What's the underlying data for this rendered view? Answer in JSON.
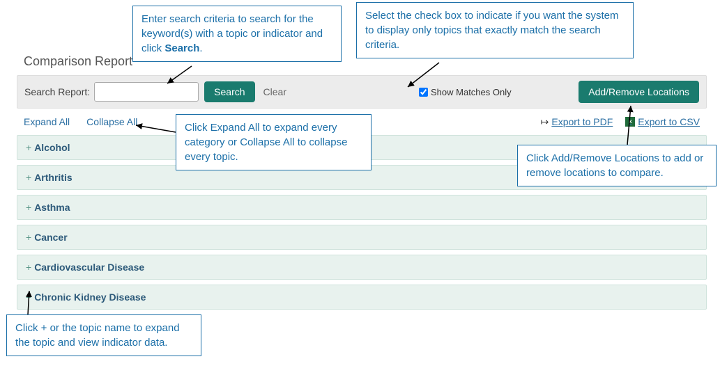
{
  "title": "Comparison Report",
  "searchbar": {
    "label": "Search Report:",
    "input_value": "",
    "search_btn": "Search",
    "clear_btn": "Clear",
    "show_matches_label": "Show Matches Only",
    "show_matches_checked": true,
    "addremove_btn": "Add/Remove Locations"
  },
  "controls": {
    "expand_all": "Expand All",
    "collapse_all": "Collapse All",
    "export_pdf": "Export to PDF",
    "export_csv": "Export to CSV"
  },
  "topics": [
    {
      "label": "Alcohol"
    },
    {
      "label": "Arthritis"
    },
    {
      "label": "Asthma"
    },
    {
      "label": "Cancer"
    },
    {
      "label": "Cardiovascular Disease"
    },
    {
      "label": "Chronic Kidney Disease"
    }
  ],
  "callouts": {
    "c1_a": "Enter search criteria to search for the keyword(s) with a topic or indicator and click ",
    "c1_b": "Search",
    "c1_c": ".",
    "c2": "Select the check box to indicate if you want the system to display only topics that exactly match the search criteria.",
    "c3": "Click Expand All to expand every category or Collapse All to collapse every topic.",
    "c4": "Click Add/Remove Locations to add or remove locations to compare.",
    "c5": "Click + or the topic name to expand the topic and view indicator data."
  }
}
